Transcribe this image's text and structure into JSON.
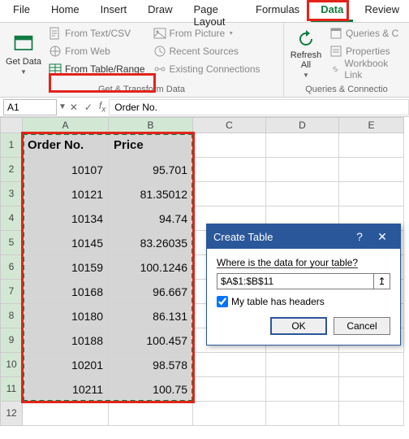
{
  "tabs": {
    "file": "File",
    "home": "Home",
    "insert": "Insert",
    "draw": "Draw",
    "pagelayout": "Page Layout",
    "formulas": "Formulas",
    "data": "Data",
    "review": "Review"
  },
  "ribbon": {
    "getdata": "Get Data",
    "from_text": "From Text/CSV",
    "from_web": "From Web",
    "from_table": "From Table/Range",
    "from_picture": "From Picture",
    "recent": "Recent Sources",
    "existing": "Existing Connections",
    "group1": "Get & Transform Data",
    "refresh": "Refresh All",
    "queries": "Queries & C",
    "properties": "Properties",
    "workbook": "Workbook Link",
    "group2": "Queries & Connectio"
  },
  "namebox": "A1",
  "formula": "Order No.",
  "cols": [
    "A",
    "B",
    "C",
    "D",
    "E"
  ],
  "rows": [
    "1",
    "2",
    "3",
    "4",
    "5",
    "6",
    "7",
    "8",
    "9",
    "10",
    "11",
    "12"
  ],
  "chart_data": {
    "type": "table",
    "headers": [
      "Order No.",
      "Price"
    ],
    "data": [
      [
        "10107",
        "95.701"
      ],
      [
        "10121",
        "81.35012"
      ],
      [
        "10134",
        "94.74"
      ],
      [
        "10145",
        "83.26035"
      ],
      [
        "10159",
        "100.1246"
      ],
      [
        "10168",
        "96.667"
      ],
      [
        "10180",
        "86.131"
      ],
      [
        "10188",
        "100.457"
      ],
      [
        "10201",
        "98.578"
      ],
      [
        "10211",
        "100.75"
      ]
    ]
  },
  "dialog": {
    "title": "Create Table",
    "label": "Where is the data for your table?",
    "range": "$A$1:$B$11",
    "check": "My table has headers",
    "ok": "OK",
    "cancel": "Cancel"
  }
}
